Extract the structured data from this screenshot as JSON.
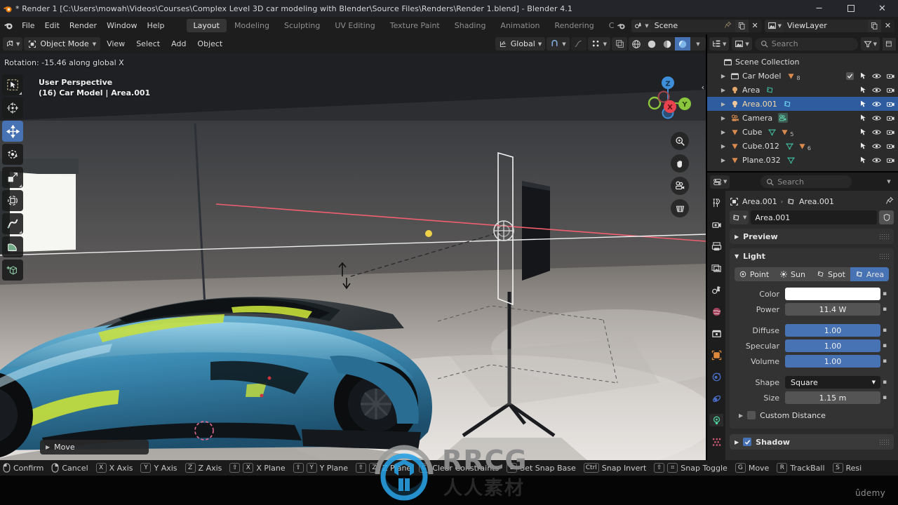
{
  "titlebar": {
    "title": "* Render 1 [C:\\Users\\mowah\\Videos\\Courses\\Complex Level 3D car modeling with Blender\\Source Files\\Renders\\Render 1.blend] - Blender 4.1",
    "minimize": "─",
    "maximize": "☐",
    "close": "✕"
  },
  "topbar": {
    "menus": [
      "File",
      "Edit",
      "Render",
      "Window",
      "Help"
    ],
    "workspaces": [
      {
        "label": "Layout",
        "active": true
      },
      {
        "label": "Modeling",
        "active": false
      },
      {
        "label": "Sculpting",
        "active": false
      },
      {
        "label": "UV Editing",
        "active": false
      },
      {
        "label": "Texture Paint",
        "active": false
      },
      {
        "label": "Shading",
        "active": false
      },
      {
        "label": "Animation",
        "active": false
      },
      {
        "label": "Rendering",
        "active": false
      },
      {
        "label": "Compos",
        "active": false
      }
    ],
    "scene": {
      "label": "Scene",
      "icon": "scene-icon",
      "pin": "pin-icon",
      "copy": "new-scene-icon",
      "remove": "✕"
    },
    "viewlayer": {
      "label": "ViewLayer",
      "icon": "viewlayer-icon",
      "copy": "new-layer-icon",
      "remove": "✕"
    }
  },
  "viewport_header": {
    "editor_type": "editor-type-icon",
    "mode": "Object Mode",
    "menus": [
      "View",
      "Select",
      "Add",
      "Object"
    ],
    "transform_orientation": "Global",
    "snap_icon": "magnet-icon",
    "proportional_icon": "proportional-edit-icon",
    "gizmo_icon": "gizmo-icon",
    "overlay_icon": "overlays-icon",
    "xray_icon": "xray-icon",
    "shading": [
      "wireframe",
      "solid",
      "material-preview",
      "rendered"
    ],
    "shading_active": "rendered"
  },
  "viewport": {
    "header_status": "Rotation: -15.46 along global X",
    "perspective": "User Perspective",
    "object_info": "(16) Car Model | Area.001",
    "tools": [
      {
        "name": "tweak-select-box-tool",
        "active": false
      },
      {
        "name": "cursor-tool",
        "active": false
      },
      {
        "name": "move-tool",
        "active": true
      },
      {
        "name": "rotate-tool",
        "active": false
      },
      {
        "name": "scale-tool",
        "active": false
      },
      {
        "name": "transform-tool",
        "active": false
      },
      {
        "name": "annotate-tool",
        "active": false
      },
      {
        "name": "measure-tool",
        "active": false
      },
      {
        "name": "add-cube-tool",
        "active": false
      }
    ],
    "gizmo_axes": [
      {
        "label": "Z",
        "color": "#3e8fd9"
      },
      {
        "label": "Y",
        "color": "#8cc63e"
      },
      {
        "label": "X",
        "color": "#e8434f"
      }
    ],
    "nav_buttons": [
      "zoom-icon",
      "hand-pan-icon",
      "camera-view-icon",
      "toggle-perspective-icon"
    ],
    "operator_panel": "Move",
    "collapse_arrow": "‹"
  },
  "outliner": {
    "display_mode_icon": "outliner-display-mode-icon",
    "filter_icon": "filter-icon",
    "search": {
      "placeholder": "Search",
      "value": ""
    },
    "scene_collection": "Scene Collection",
    "rows": [
      {
        "name": "Car Model",
        "icon": "collection-icon",
        "badges": [
          "mesh-data-orange"
        ],
        "count": "8",
        "checkbox": true,
        "selected": false,
        "indent": 1
      },
      {
        "name": "Area",
        "icon": "light-icon",
        "badges": [
          "light-data-green"
        ],
        "count": "",
        "checkbox": false,
        "selected": false,
        "indent": 1
      },
      {
        "name": "Area.001",
        "icon": "light-icon",
        "badges": [
          "light-data-green"
        ],
        "count": "",
        "checkbox": false,
        "selected": true,
        "indent": 1
      },
      {
        "name": "Camera",
        "icon": "camera-icon",
        "badges": [
          "camera-data-green"
        ],
        "count": "",
        "checkbox": false,
        "selected": false,
        "indent": 1
      },
      {
        "name": "Cube",
        "icon": "mesh-icon",
        "badges": [
          "mesh-data-green",
          "modifier-orange"
        ],
        "count": "5",
        "checkbox": false,
        "selected": false,
        "indent": 1
      },
      {
        "name": "Cube.012",
        "icon": "mesh-icon",
        "badges": [
          "mesh-data-green",
          "modifier-orange"
        ],
        "count": "6",
        "checkbox": false,
        "selected": false,
        "indent": 1
      },
      {
        "name": "Plane.032",
        "icon": "mesh-icon",
        "badges": [
          "mesh-data-green"
        ],
        "count": "",
        "checkbox": false,
        "selected": false,
        "indent": 1
      }
    ]
  },
  "properties": {
    "search": {
      "placeholder": "Search",
      "value": ""
    },
    "editor_icon": "properties-editor-icon",
    "tabs": [
      {
        "name": "tool-tab",
        "icon": "tool-icon",
        "active": false
      },
      {
        "name": "render-tab",
        "icon": "render-camera-icon",
        "active": false
      },
      {
        "name": "output-tab",
        "icon": "printer-icon",
        "active": false
      },
      {
        "name": "view-layer-tab",
        "icon": "images-icon",
        "active": false
      },
      {
        "name": "scene-tab",
        "icon": "scene-cone-icon",
        "active": false
      },
      {
        "name": "world-tab",
        "icon": "world-globe-icon",
        "active": false
      },
      {
        "name": "collection-tab",
        "icon": "collection-box-icon",
        "active": false
      },
      {
        "name": "object-tab",
        "icon": "object-square-icon",
        "active": false
      },
      {
        "name": "modifiers-tab",
        "icon": "wrench-icon",
        "active": false
      },
      {
        "name": "physics-tab",
        "icon": "physics-orbit-icon",
        "active": false
      },
      {
        "name": "object-data-tab",
        "icon": "light-bulb-icon",
        "active": true
      },
      {
        "name": "texture-tab",
        "icon": "checker-texture-icon",
        "active": false
      }
    ],
    "breadcrumb": {
      "object": "Area.001",
      "data": "Area.001",
      "sep": "›",
      "pin": "pin-icon"
    },
    "id_name": "Area.001",
    "preview_panel": {
      "label": "Preview",
      "expanded": false,
      "tri": "›"
    },
    "light_panel": {
      "label": "Light",
      "expanded": true,
      "tri": "⌄"
    },
    "light_types": [
      {
        "label": "Point",
        "active": false
      },
      {
        "label": "Sun",
        "active": false
      },
      {
        "label": "Spot",
        "active": false
      },
      {
        "label": "Area",
        "active": true
      }
    ],
    "fields": [
      {
        "label": "Color",
        "value": "",
        "style": "white",
        "anim": "▪"
      },
      {
        "label": "Power",
        "value": "11.4 W",
        "style": "grey",
        "anim": "▪"
      },
      {
        "label": "Diffuse",
        "value": "1.00",
        "style": "blue",
        "anim": "▪"
      },
      {
        "label": "Specular",
        "value": "1.00",
        "style": "blue",
        "anim": "▪"
      },
      {
        "label": "Volume",
        "value": "1.00",
        "style": "blue",
        "anim": "▪"
      },
      {
        "label": "Shape",
        "value": "Square",
        "style": "dark",
        "anim": "▪"
      },
      {
        "label": "Size",
        "value": "1.15 m",
        "style": "grey",
        "anim": "▪"
      }
    ],
    "custom_distance": {
      "label": "Custom Distance",
      "checked": false,
      "tri": "›"
    },
    "shadow": {
      "label": "Shadow",
      "checked": true,
      "tri": "›"
    }
  },
  "statusbar": {
    "items": [
      {
        "keys": [
          "mouse-left"
        ],
        "label": "Confirm"
      },
      {
        "keys": [
          "mouse-right"
        ],
        "label": "Cancel"
      },
      {
        "keys": [
          "X"
        ],
        "label": "X Axis"
      },
      {
        "keys": [
          "Y"
        ],
        "label": "Y Axis"
      },
      {
        "keys": [
          "Z"
        ],
        "label": "Z Axis"
      },
      {
        "keys": [
          "⇧",
          "X"
        ],
        "label": "X Plane"
      },
      {
        "keys": [
          "⇧",
          "Y"
        ],
        "label": "Y Plane"
      },
      {
        "keys": [
          "⇧",
          "Z"
        ],
        "label": "Z Plane"
      },
      {
        "keys": [
          "C"
        ],
        "label": "Clear Constraints"
      },
      {
        "keys": [
          "B"
        ],
        "label": "Set Snap Base"
      },
      {
        "keys": [
          "Ctrl"
        ],
        "label": "Snap Invert"
      },
      {
        "keys": [
          "⇧",
          "⌗"
        ],
        "label": "Snap Toggle"
      },
      {
        "keys": [
          "G"
        ],
        "label": "Move"
      },
      {
        "keys": [
          "R"
        ],
        "label": "TrackBall"
      },
      {
        "keys": [
          "S"
        ],
        "label": "Resi"
      }
    ]
  },
  "watermark": {
    "brand": "RRCG",
    "sub": "人人素材"
  },
  "footer": {
    "udemy": "ûdemy"
  },
  "colors": {
    "accent_blue": "#4772b3",
    "select_blue": "#2f5c9e",
    "panel_bg": "#2b2b2b",
    "header_bg": "#1d1d1d",
    "axis_x": "#e8434f",
    "axis_y": "#8cc63e",
    "axis_z": "#3e8fd9",
    "light_orange": "#e2a56a",
    "mesh_green": "#42b39a"
  }
}
